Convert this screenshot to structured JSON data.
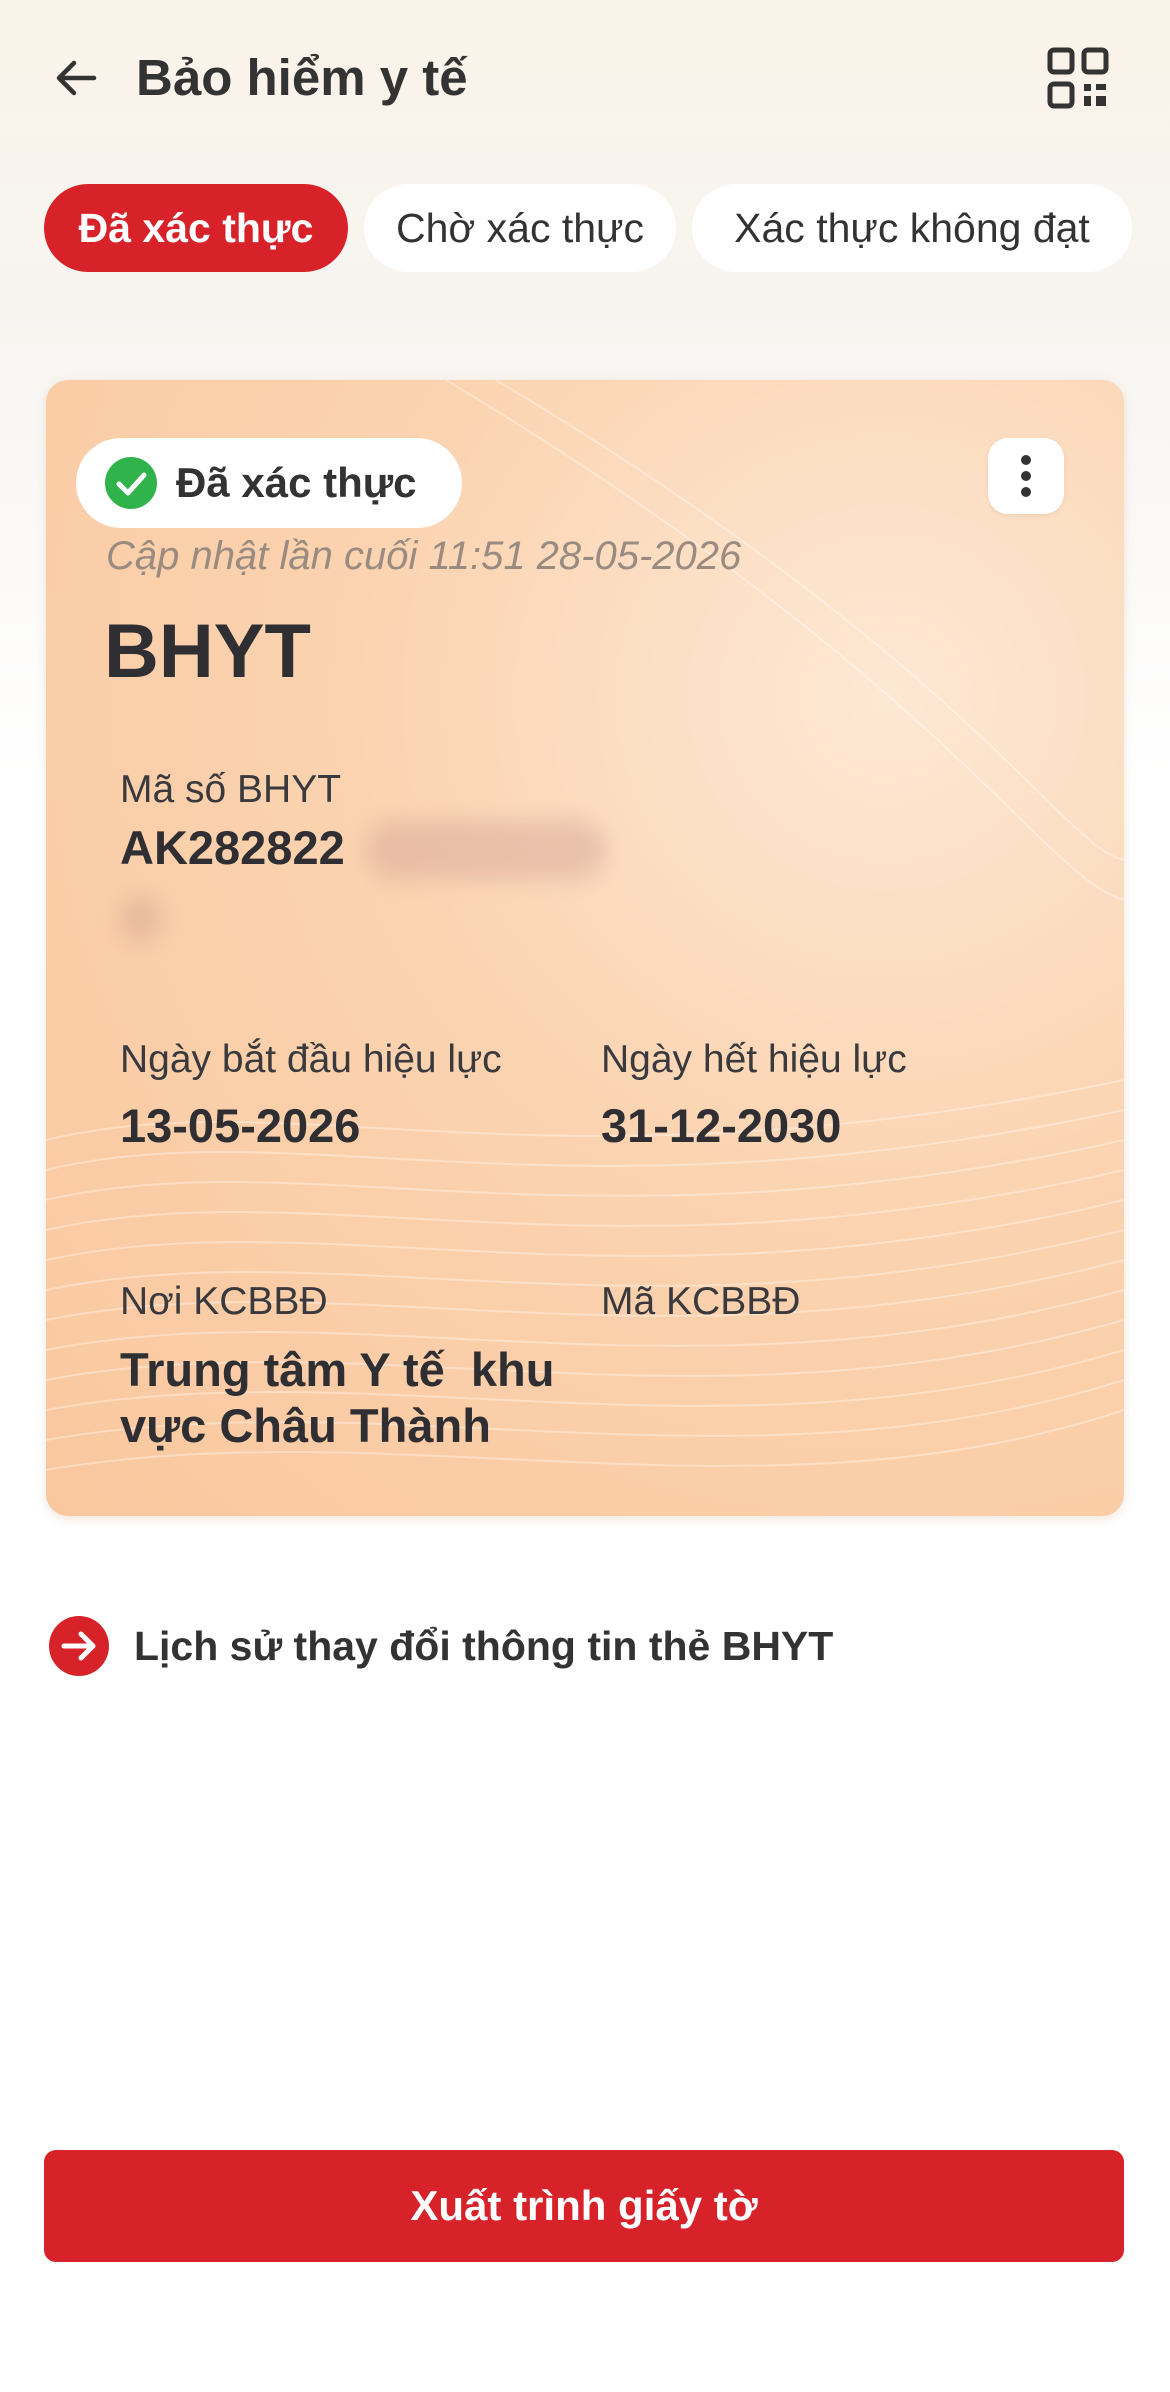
{
  "header": {
    "title": "Bảo hiểm y tế",
    "back_icon": "arrow-left-icon",
    "qr_icon": "qr-code-icon"
  },
  "tabs": [
    {
      "label": "Đã xác thực",
      "active": true
    },
    {
      "label": "Chờ xác thực",
      "active": false
    },
    {
      "label": "Xác thực không đạt",
      "active": false
    }
  ],
  "card": {
    "status_label": "Đã xác thực",
    "status_icon": "check-circle-icon",
    "status_color": "#2fb34a",
    "last_updated": "Cập nhật lần cuối 11:51 28-05-2026",
    "type": "BHYT",
    "insurance_number_label": "Mã số BHYT",
    "insurance_number_visible": "AK282822",
    "start_date_label": "Ngày bắt đầu hiệu lực",
    "start_date": "13-05-2026",
    "end_date_label": "Ngày hết hiệu lực",
    "end_date": "31-12-2030",
    "facility_label": "Nơi KCBBĐ",
    "facility_line1": "Trung tâm Y tế  khu",
    "facility_line2": "vực Châu Thành",
    "facility_code_label": "Mã KCBBĐ",
    "facility_code": ""
  },
  "history_link": {
    "label": "Lịch sử thay đổi thông tin thẻ BHYT",
    "icon": "arrow-right-circle-icon"
  },
  "primary_action": {
    "label": "Xuất trình giấy tờ"
  },
  "colors": {
    "accent": "#d8222a",
    "card_bg": "#fbd3b0"
  }
}
